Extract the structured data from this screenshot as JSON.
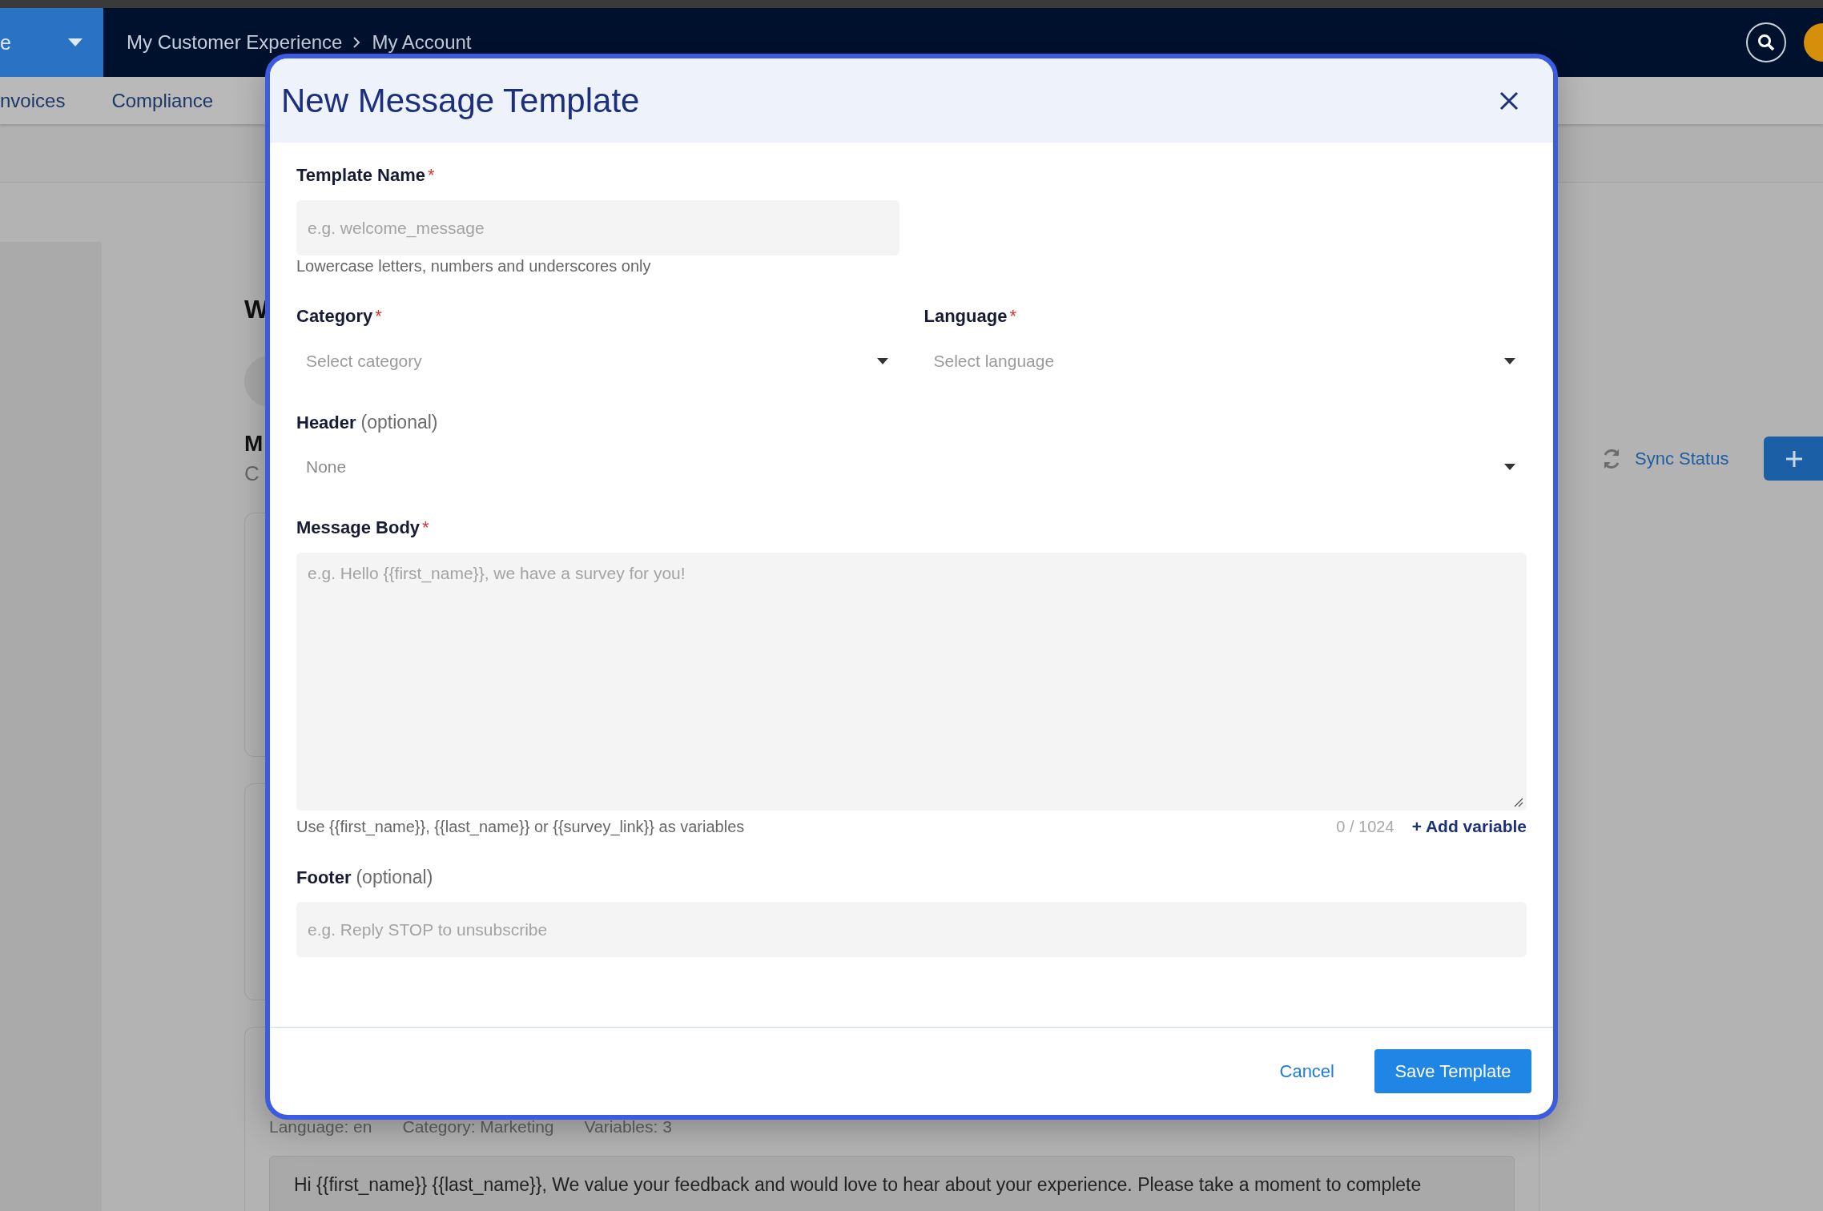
{
  "top_bar": {
    "menu_label": "e",
    "breadcrumb": [
      "My Customer Experience",
      "My Account"
    ]
  },
  "sub_nav": [
    "nvoices",
    "Compliance"
  ],
  "page": {
    "heading": "W",
    "section_title": "M",
    "section_subtitle": "C",
    "sync_status": "Sync Status",
    "template_meta": [
      "Language: en",
      "Category: Marketing",
      "Variables: 3"
    ],
    "template_preview": "Hi {{first_name}} {{last_name}}, We value your feedback and would love to hear about your experience. Please take a moment to complete"
  },
  "modal": {
    "title": "New Message Template",
    "rows": [
      [
        {
          "kind": "short_text",
          "label": "Template Name",
          "required_mark": "*",
          "placeholder": "e.g. welcome_message",
          "help": "Lowercase letters, numbers and underscores only"
        }
      ],
      [
        {
          "kind": "select",
          "label": "Category",
          "required_mark": "*",
          "placeholder": "Select category"
        },
        {
          "kind": "select",
          "label": "Language",
          "required_mark": "*",
          "placeholder": "Select language"
        }
      ],
      [
        {
          "kind": "select",
          "label": "Header",
          "note": "(optional)",
          "value": "None"
        }
      ],
      [
        {
          "kind": "textarea",
          "label": "Message Body",
          "required_mark": "*",
          "placeholder": "e.g. Hello {{first_name}}, we have a survey for you!",
          "help": "Use {{first_name}}, {{last_name}} or {{survey_link}} as variables",
          "counter": "0 / 1024",
          "action": "+ Add variable"
        }
      ],
      [
        {
          "kind": "text",
          "label": "Footer",
          "note": "(optional)",
          "placeholder": "e.g. Reply STOP to unsubscribe"
        }
      ]
    ],
    "cancel": "Cancel",
    "save": "Save Template"
  }
}
